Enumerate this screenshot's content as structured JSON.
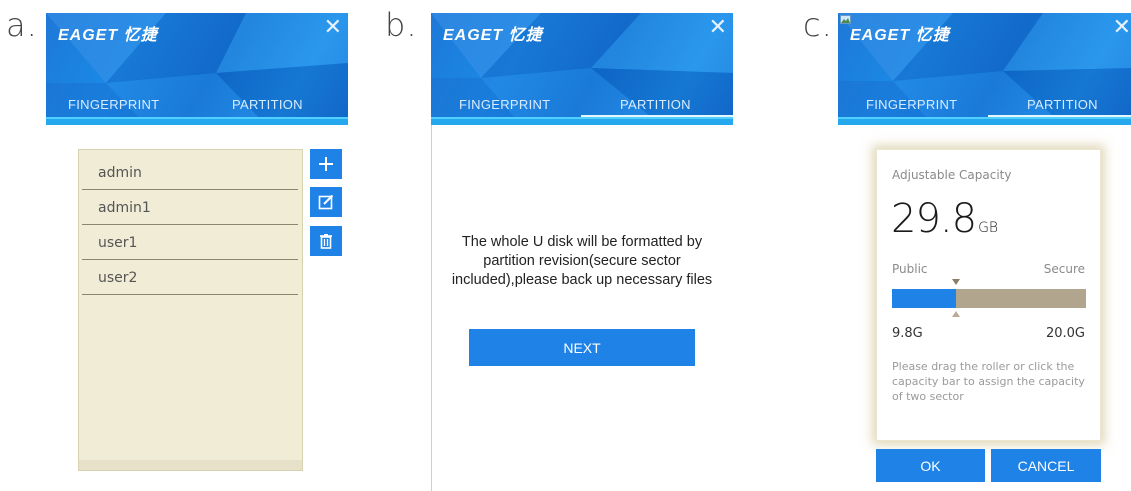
{
  "panels": {
    "a": {
      "letter": "a."
    },
    "b": {
      "letter": "b."
    },
    "c": {
      "letter": "c."
    }
  },
  "header": {
    "logo": "EAGET 忆捷",
    "close_symbol": "✕",
    "tabs": [
      {
        "label": "FINGERPRINT"
      },
      {
        "label": "PARTITION"
      }
    ]
  },
  "panel_a": {
    "active_tab": "PARTITION",
    "users": [
      {
        "name": "admin"
      },
      {
        "name": "admin1"
      },
      {
        "name": "user1"
      },
      {
        "name": "user2"
      }
    ],
    "actions": [
      {
        "icon": "plus-icon"
      },
      {
        "icon": "edit-icon"
      },
      {
        "icon": "trash-icon"
      }
    ]
  },
  "panel_b": {
    "active_tab": "PARTITION",
    "message": "The whole U disk will be formatted by partition revision(secure sector included),please back up necessary files",
    "next_label": "NEXT"
  },
  "panel_c": {
    "active_tab": "PARTITION",
    "capacity_label": "Adjustable Capacity",
    "capacity_value": "29.8",
    "capacity_unit": "GB",
    "public_label": "Public",
    "secure_label": "Secure",
    "public_size": "9.8G",
    "secure_size": "20.0G",
    "public_fraction": 0.33,
    "hint": "Please drag the roller or click the capacity bar to assign the capacity of two sector",
    "ok_label": "OK",
    "cancel_label": "CANCEL"
  },
  "colors": {
    "accent": "#1e82e6",
    "secure_bar": "#b1a68d",
    "list_bg": "#f0ecd6"
  }
}
